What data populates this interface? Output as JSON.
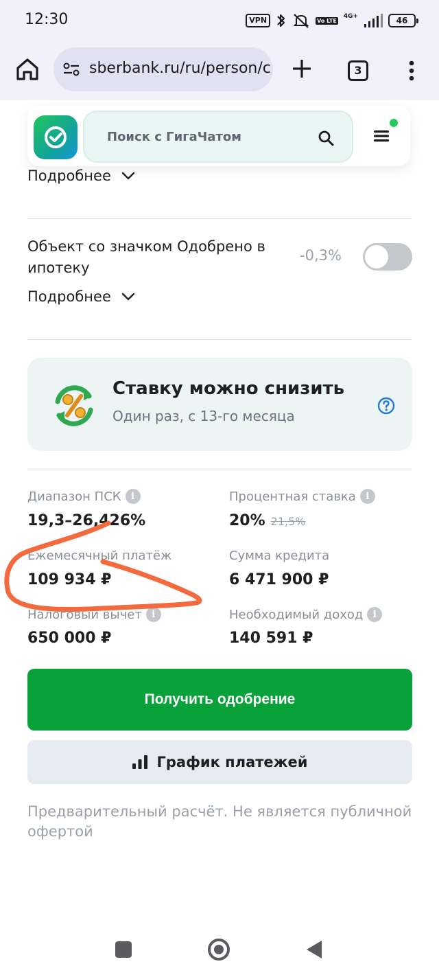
{
  "status_bar": {
    "time": "12:30",
    "vpn": "VPN",
    "volte": "Vo LTE",
    "network": "4G+",
    "battery": "46"
  },
  "browser": {
    "url": "sberbank.ru/ru/person/c",
    "tab_count": "3"
  },
  "header": {
    "search_placeholder": "Поиск с ГигаЧатом"
  },
  "options": {
    "more_label": "Подробнее",
    "item": {
      "title": "Объект со значком Одобрено в ипотеку",
      "discount": "-0,3%",
      "enabled": false
    }
  },
  "promo": {
    "title": "Ставку можно снизить",
    "subtitle": "Один раз, с 13-го месяца"
  },
  "stats": {
    "psk_label": "Диапазон ПСК",
    "psk_value": "19,3–26,426%",
    "rate_label": "Процентная ставка",
    "rate_value": "20%",
    "rate_old": "21,5%",
    "payment_label": "Ежемесячный платёж",
    "payment_value": "109 934 ₽",
    "loan_label": "Сумма кредита",
    "loan_value": "6 471 900 ₽",
    "tax_label": "Налоговый вычет",
    "tax_value": "650 000 ₽",
    "income_label": "Необходимый доход",
    "income_value": "140 591 ₽"
  },
  "actions": {
    "primary": "Получить одобрение",
    "schedule": "График платежей"
  },
  "disclaimer": "Предварительный расчёт. Не является публичной офертой",
  "colors": {
    "primary_green": "#08a13a",
    "annotation_orange": "#f26a3d",
    "status_bar_bg": "#f1f0fb"
  }
}
